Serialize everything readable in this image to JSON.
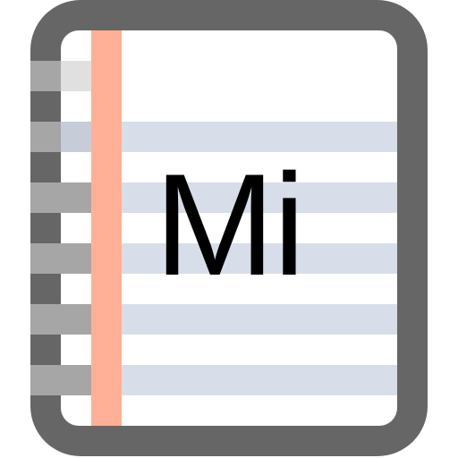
{
  "icon": {
    "name": "notebook-icon",
    "label": "Mi"
  },
  "colors": {
    "frame": "#666666",
    "page": "#ffffff",
    "margin_line": "#ffb096",
    "ruled_line": "#d7deea",
    "ring_dark": "#666666",
    "ring_light": "#a6a6a6",
    "ring_highlight": "#e0e0e0",
    "ring_blue": "#c6ccd8",
    "text": "#000000"
  }
}
